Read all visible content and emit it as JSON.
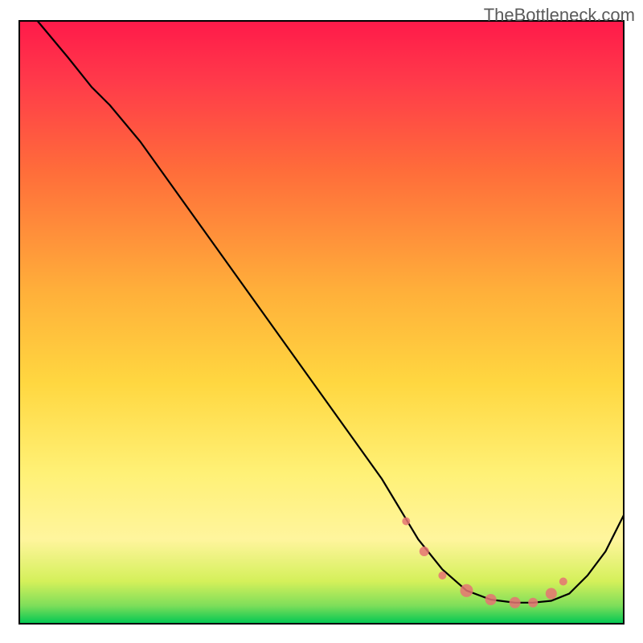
{
  "watermark": "TheBottleneck.com",
  "chart_data": {
    "type": "line",
    "title": "",
    "xlabel": "",
    "ylabel": "",
    "xlim": [
      0,
      100
    ],
    "ylim": [
      0,
      100
    ],
    "series": [
      {
        "name": "curve",
        "x": [
          3,
          8,
          12,
          15,
          20,
          25,
          30,
          35,
          40,
          45,
          50,
          55,
          60,
          63,
          66,
          70,
          74,
          78,
          82,
          85,
          88,
          91,
          94,
          97,
          100
        ],
        "y": [
          100,
          94,
          89,
          86,
          80,
          73,
          66,
          59,
          52,
          45,
          38,
          31,
          24,
          19,
          14,
          9,
          5.5,
          4,
          3.5,
          3.5,
          3.8,
          5,
          8,
          12,
          18
        ]
      }
    ],
    "markers": [
      {
        "x": 64,
        "y": 17,
        "r": 5
      },
      {
        "x": 67,
        "y": 12,
        "r": 6
      },
      {
        "x": 70,
        "y": 8,
        "r": 5
      },
      {
        "x": 74,
        "y": 5.5,
        "r": 8
      },
      {
        "x": 78,
        "y": 4,
        "r": 7
      },
      {
        "x": 82,
        "y": 3.5,
        "r": 7
      },
      {
        "x": 85,
        "y": 3.5,
        "r": 6
      },
      {
        "x": 88,
        "y": 5,
        "r": 7
      },
      {
        "x": 90,
        "y": 7,
        "r": 5
      }
    ],
    "gradient_colors": {
      "top": "#ff1744",
      "mid_upper": "#ff6d3a",
      "mid": "#ffca28",
      "mid_lower": "#fff176",
      "lower": "#d4f05a",
      "bottom": "#00c853"
    },
    "frame_color": "#000000",
    "curve_color": "#000000",
    "marker_color": "#e57373"
  }
}
